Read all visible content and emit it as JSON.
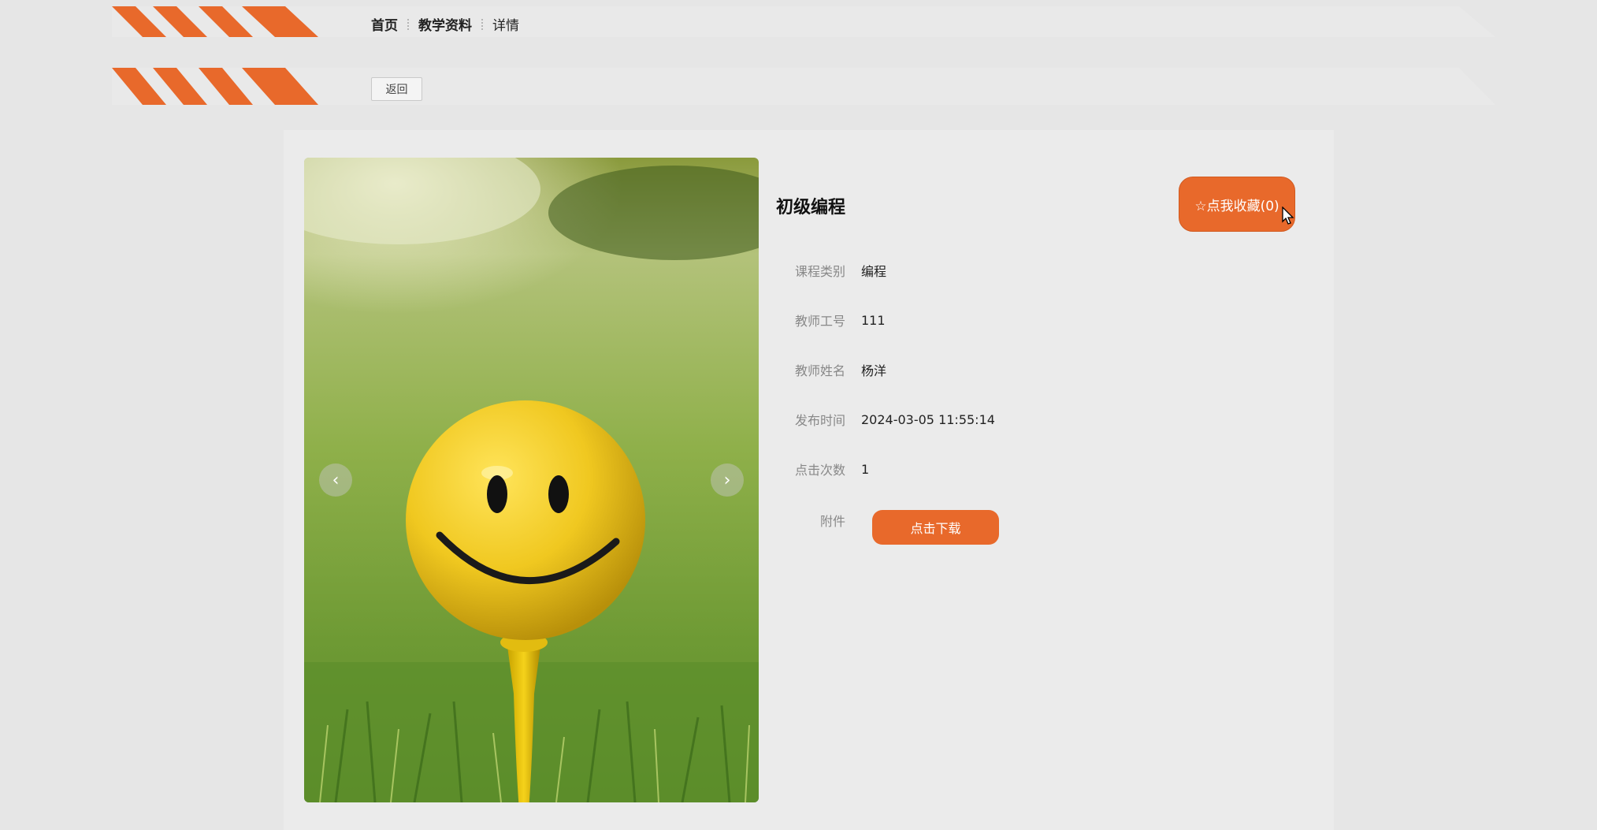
{
  "breadcrumb": {
    "home": "首页",
    "section": "教学资料",
    "current": "详情"
  },
  "actions": {
    "back_label": "返回"
  },
  "course": {
    "title": "初级编程",
    "favorite_label": "☆点我收藏(0)",
    "fields": [
      {
        "label": "课程类别",
        "value": "编程"
      },
      {
        "label": "教师工号",
        "value": "111"
      },
      {
        "label": "教师姓名",
        "value": "杨洋"
      },
      {
        "label": "发布时间",
        "value": "2024-03-05 11:55:14"
      },
      {
        "label": "点击次数",
        "value": "1"
      }
    ],
    "attachment_label": "附件",
    "download_label": "点击下载"
  },
  "carousel": {
    "prev_glyph": "‹",
    "next_glyph": "›"
  },
  "colors": {
    "accent": "#e8692b",
    "background": "#e6e6e6",
    "panel": "#ebebeb"
  },
  "icons": {
    "favorite": "star-outline-icon",
    "prev": "chevron-left-icon",
    "next": "chevron-right-icon"
  }
}
